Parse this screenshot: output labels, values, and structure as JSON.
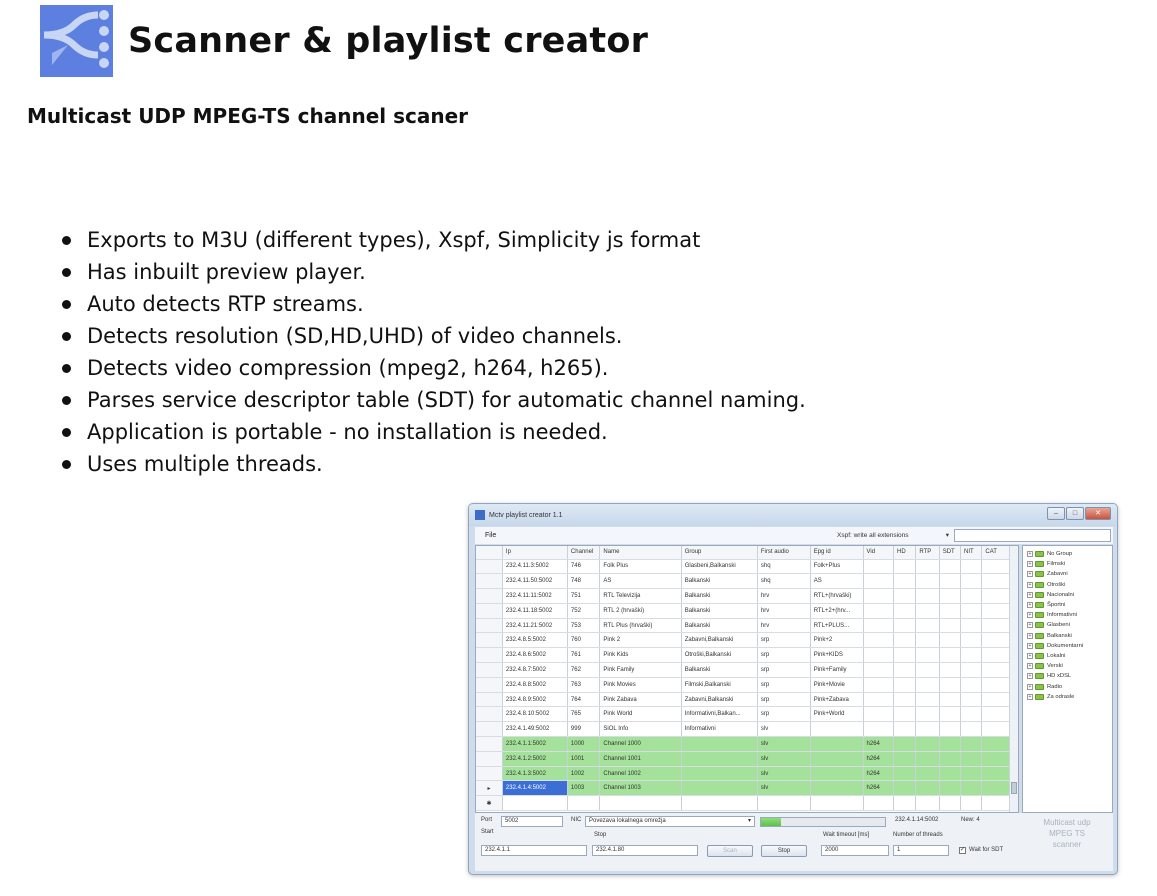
{
  "header": {
    "title": "Scanner & playlist creator",
    "subtitle": "Multicast UDP MPEG-TS channel scaner"
  },
  "features": [
    "Exports to M3U (different types), Xspf, Simplicity js format",
    "Has inbuilt preview player.",
    "Auto detects RTP streams.",
    "Detects resolution (SD,HD,UHD) of video channels.",
    "Detects video compression (mpeg2, h264, h265).",
    "Parses service descriptor table (SDT) for automatic channel naming.",
    "Application is portable - no installation is needed.",
    "Uses multiple threads."
  ],
  "app": {
    "window_title": "Mctv playlist creator 1.1",
    "menu_file": "File",
    "export_option": "Xspf: write all extensions",
    "columns": [
      "Ip",
      "Channel",
      "Name",
      "Group",
      "First audio",
      "Epg id",
      "Vid",
      "HD",
      "RTP",
      "SDT",
      "NIT",
      "CAT"
    ],
    "rows": [
      [
        "232.4.11.3:5002",
        "746",
        "Folk Plus",
        "Glasbeni,Balkanski",
        "shq",
        "Folk+Plus",
        "",
        "",
        "",
        "",
        "",
        ""
      ],
      [
        "232.4.11.50:5002",
        "748",
        "AS",
        "Balkanski",
        "shq",
        "AS",
        "",
        "",
        "",
        "",
        "",
        ""
      ],
      [
        "232.4.11.11:5002",
        "751",
        "RTL Televizija",
        "Balkanski",
        "hrv",
        "RTL+(hrvaški)",
        "",
        "",
        "",
        "",
        "",
        ""
      ],
      [
        "232.4.11.18:5002",
        "752",
        "RTL 2 (hrvaški)",
        "Balkanski",
        "hrv",
        "RTL+2+(hrv...",
        "",
        "",
        "",
        "",
        "",
        ""
      ],
      [
        "232.4.11.21:5002",
        "753",
        "RTL Plus (hrvaški)",
        "Balkanski",
        "hrv",
        "RTL+PLUS...",
        "",
        "",
        "",
        "",
        "",
        ""
      ],
      [
        "232.4.8.5:5002",
        "760",
        "Pink 2",
        "Zabavni,Balkanski",
        "srp",
        "Pink+2",
        "",
        "",
        "",
        "",
        "",
        ""
      ],
      [
        "232.4.8.6:5002",
        "761",
        "Pink Kids",
        "Otroški,Balkanski",
        "srp",
        "Pink+KIDS",
        "",
        "",
        "",
        "",
        "",
        ""
      ],
      [
        "232.4.8.7:5002",
        "762",
        "Pink Family",
        "Balkanski",
        "srp",
        "Pink+Family",
        "",
        "",
        "",
        "",
        "",
        ""
      ],
      [
        "232.4.8.8:5002",
        "763",
        "Pink Movies",
        "Filmski,Balkanski",
        "srp",
        "Pink+Movie",
        "",
        "",
        "",
        "",
        "",
        ""
      ],
      [
        "232.4.8.9:5002",
        "764",
        "Pink Zabava",
        "Zabavni,Balkanski",
        "srp",
        "Pink+Zabava",
        "",
        "",
        "",
        "",
        "",
        ""
      ],
      [
        "232.4.8.10:5002",
        "765",
        "Pink World",
        "Informativni,Balkan...",
        "srp",
        "Pink+World",
        "",
        "",
        "",
        "",
        "",
        ""
      ],
      [
        "232.4.1.49:5002",
        "999",
        "SiOL Info",
        "Informativni",
        "slv",
        "",
        "",
        "",
        "",
        "",
        "",
        ""
      ],
      [
        "232.4.1.1:5002",
        "1000",
        "Channel 1000",
        "",
        "slv",
        "",
        "h264",
        "",
        "",
        "",
        "",
        ""
      ],
      [
        "232.4.1.2:5002",
        "1001",
        "Channel 1001",
        "",
        "slv",
        "",
        "h264",
        "",
        "",
        "",
        "",
        ""
      ],
      [
        "232.4.1.3:5002",
        "1002",
        "Channel 1002",
        "",
        "slv",
        "",
        "h264",
        "",
        "",
        "",
        "",
        ""
      ],
      [
        "232.4.1.4:5002",
        "1003",
        "Channel 1003",
        "",
        "slv",
        "",
        "h264",
        "",
        "",
        "",
        "",
        ""
      ]
    ],
    "tree": [
      "No Group",
      "Filmski",
      "Zabavni",
      "Otroški",
      "Nacionalni",
      "Športni",
      "Informativni",
      "Glasbeni",
      "Balkanski",
      "Dokumentarni",
      "Lokalni",
      "Verski",
      "HD xDSL",
      "Radio",
      "Za odrasle"
    ],
    "port_label": "Port",
    "port_value": "5002",
    "nic_label": "NIC",
    "nic_value": "Povezava lokalnega omrežja",
    "start_label": "Start",
    "start_value": "232.4.1.1",
    "stop_label": "Stop",
    "stop_value": "232.4.1.80",
    "current_ip": "232.4.1.14:5002",
    "new_count": "New: 4",
    "scan_button": "Scan",
    "stop_button": "Stop",
    "wait_timeout_label": "Wait timeout [ms]",
    "wait_timeout_value": "2000",
    "threads_label": "Number of threads",
    "threads_value": "1",
    "wait_sdt_label": "Wait for SDT",
    "brand_text": "Multicast udp MPEG TS scanner"
  }
}
